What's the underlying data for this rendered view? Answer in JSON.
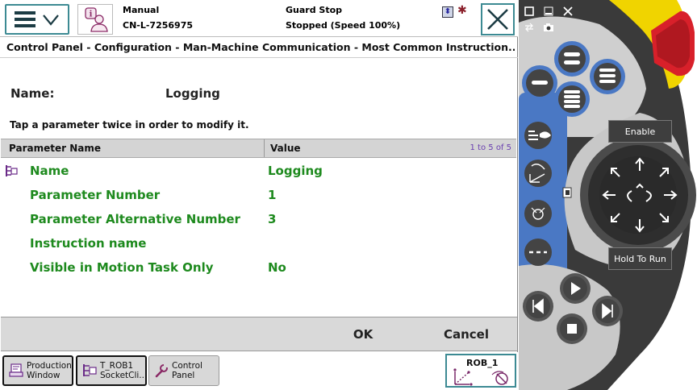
{
  "topbar": {
    "menu_icon": "hamburger-icon",
    "hotedit_icon": "info-user-icon",
    "mode": "Manual",
    "controller": "CN-L-7256975",
    "safety_state": "Guard Stop",
    "motion_state": "Stopped (Speed 100%)",
    "close_icon": "close-icon"
  },
  "breadcrumb": "Control Panel - Configuration - Man-Machine Communication - Most Common Instruction...",
  "instruction": {
    "name_label": "Name:",
    "name_value": "Logging",
    "hint": "Tap a parameter twice in order to modify it."
  },
  "grid": {
    "col_name": "Parameter Name",
    "col_value": "Value",
    "paging": "1 to 5 of 5",
    "rows": [
      {
        "name": "Name",
        "value": "Logging"
      },
      {
        "name": "Parameter Number",
        "value": "1"
      },
      {
        "name": "Parameter Alternative Number",
        "value": "3"
      },
      {
        "name": "Instruction name",
        "value": ""
      },
      {
        "name": "Visible in Motion Task Only",
        "value": "No"
      }
    ]
  },
  "commands": {
    "ok": "OK",
    "cancel": "Cancel"
  },
  "taskbar": {
    "items": [
      {
        "line1": "Production",
        "line2": "Window"
      },
      {
        "line1": "T_ROB1",
        "line2": "SocketCli..."
      },
      {
        "line1": "Control",
        "line2": "Panel"
      }
    ],
    "quickset": "ROB_1"
  },
  "pendant": {
    "enable_label": "Enable",
    "hold_label": "Hold To Run"
  },
  "colors": {
    "accent": "#3c8a93",
    "param_green": "#1e8a1e",
    "pendant_gray": "#3a3a3a",
    "pendant_blue": "#4a78c4",
    "estop_red": "#d8202a",
    "estop_yellow": "#f0d400"
  }
}
